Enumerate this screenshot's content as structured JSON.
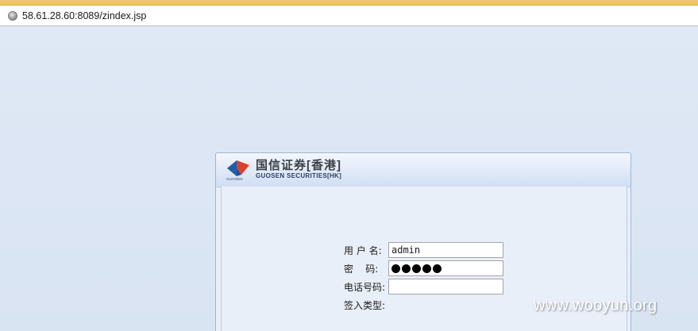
{
  "browser": {
    "url": "58.61.28.60:8089/zindex.jsp",
    "globe_icon": "globe-icon"
  },
  "logo": {
    "name_cn": "国信证券[香港]",
    "name_en": "GUOSEN SECURITIES[HK]",
    "mark_text": "GUOSEN",
    "colors": {
      "red": "#d9412b",
      "blue": "#1f5fa8"
    }
  },
  "login": {
    "username_label": "用 户 名:",
    "username_value": "admin",
    "password_label": "密    码:",
    "password_dot_count": 5,
    "phone_label": "电话号码:",
    "phone_value": "",
    "signin_type_label": "签入类型:"
  },
  "watermark": "www.wooyun.org",
  "colors": {
    "page_background": "#dde7f4",
    "panel_border": "#9eb6d6",
    "top_strip": "#f0c66a"
  }
}
